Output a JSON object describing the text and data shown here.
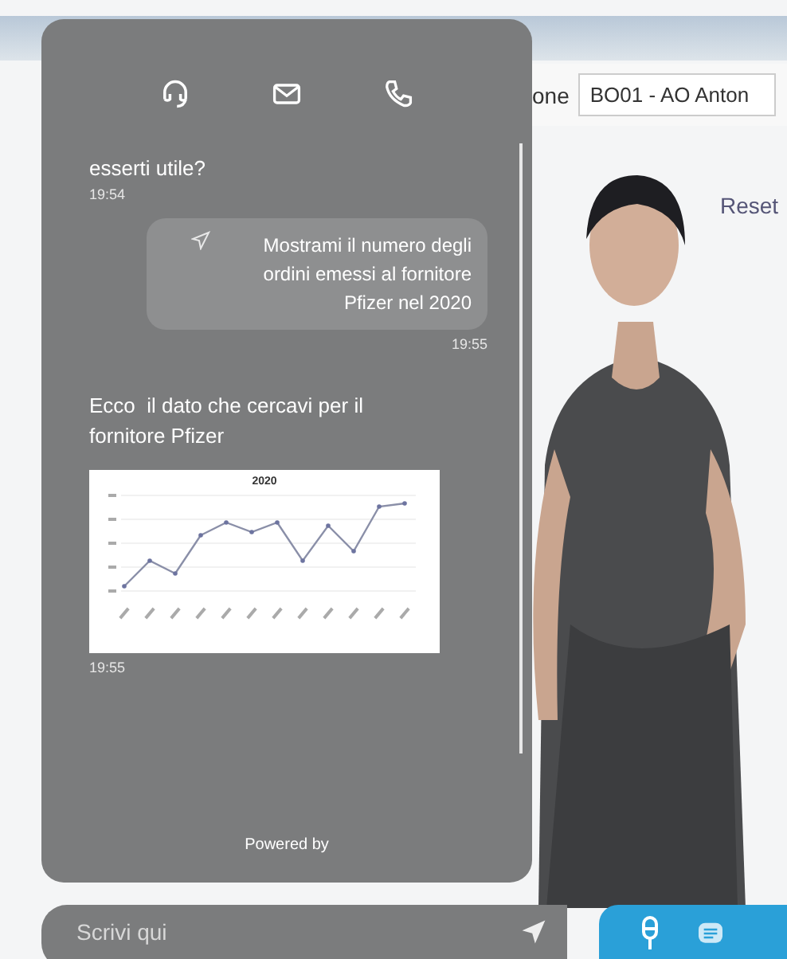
{
  "page": {
    "filter_label": "one",
    "filter_value": "BO01 - AO Anton",
    "reset_label": "Reset"
  },
  "chat": {
    "messages": [
      {
        "kind": "bot-text",
        "text": "esserti utile?",
        "time": "19:54"
      },
      {
        "kind": "user",
        "text": "Mostrami il numero degli ordini emessi al fornitore Pfizer nel 2020",
        "time": "19:55"
      },
      {
        "kind": "bot-chart",
        "text": "Ecco  il dato che cercavi per il fornitore Pfizer",
        "chart_title": "2020",
        "time": "19:55"
      }
    ],
    "footer": "Powered by",
    "input": {
      "placeholder": "Scrivi qui"
    }
  }
}
